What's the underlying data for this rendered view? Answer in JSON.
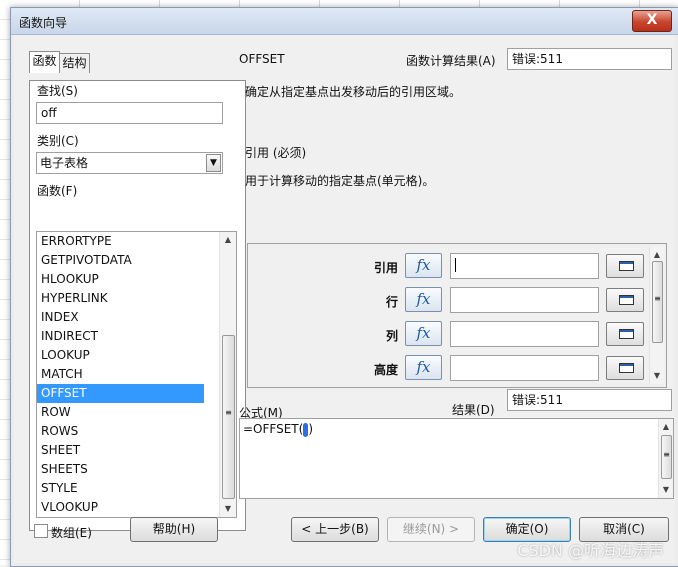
{
  "window": {
    "title": "函数向导",
    "close_label": "X"
  },
  "tabs": [
    {
      "label": "函数"
    },
    {
      "label": "结构"
    }
  ],
  "left": {
    "search_label": "查找(S)",
    "search_value": "off",
    "category_label": "类别(C)",
    "category_value": "电子表格",
    "function_label": "函数(F)",
    "functions": [
      "ERRORTYPE",
      "GETPIVOTDATA",
      "HLOOKUP",
      "HYPERLINK",
      "INDEX",
      "INDIRECT",
      "LOOKUP",
      "MATCH",
      "OFFSET",
      "ROW",
      "ROWS",
      "SHEET",
      "SHEETS",
      "STYLE",
      "VLOOKUP"
    ],
    "selected_index": 8
  },
  "right": {
    "function_name": "OFFSET",
    "result_label": "函数计算结果(A)",
    "result_value": "错误:511",
    "description": "确定从指定基点出发移动后的引用区域。",
    "arg_title": "引用 (必须)",
    "arg_desc": "用于计算移动的指定基点(单元格)。",
    "args": [
      {
        "name": "引用"
      },
      {
        "name": "行"
      },
      {
        "name": "列"
      },
      {
        "name": "高度"
      }
    ],
    "fx_label": "fx",
    "formula_label": "公式(M)",
    "formula_value": "=OFFSET()",
    "formula_text": "=OFFSET(",
    "formula_close": ")",
    "result2_label": "结果(D)",
    "result2_value": "错误:511"
  },
  "footer": {
    "array_label": "数组(E)",
    "help": "帮助(H)",
    "back": "< 上一步(B)",
    "next": "继续(N) >",
    "ok": "确定(O)",
    "cancel": "取消(C)"
  },
  "watermark": "CSDN @听海边涛声",
  "accent_color": "#3399ff"
}
